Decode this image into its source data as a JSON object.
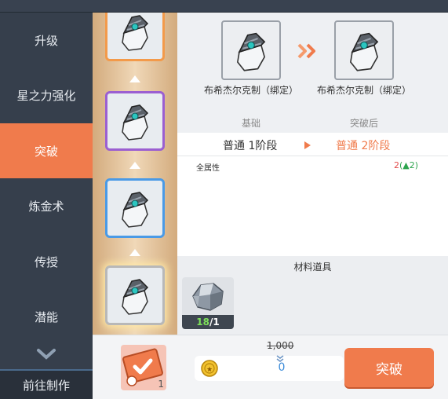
{
  "sidebar": {
    "items": [
      {
        "label": "升级",
        "active": false
      },
      {
        "label": "星之力强化",
        "active": false
      },
      {
        "label": "突破",
        "active": true
      },
      {
        "label": "炼金术",
        "active": false
      },
      {
        "label": "传授",
        "active": false
      },
      {
        "label": "潜能",
        "active": false
      }
    ],
    "footer_label": "前往制作"
  },
  "item_column": {
    "slots": [
      {
        "border": "orange",
        "icon": "glove-icon"
      },
      {
        "border": "purple",
        "icon": "glove-icon"
      },
      {
        "border": "blue",
        "icon": "glove-icon"
      },
      {
        "border": "current",
        "icon": "glove-icon"
      }
    ]
  },
  "compare": {
    "before": {
      "name": "布希杰尔克制（绑定）",
      "tag": "基础"
    },
    "after": {
      "name": "布希杰尔克制（绑定）",
      "tag": "突破后"
    },
    "stage_before": "普通 1阶段",
    "stage_after": "普通 2阶段"
  },
  "attributes": [
    {
      "label": "全属性",
      "value": "2",
      "increase": "(▲2)"
    }
  ],
  "materials": {
    "title": "材料道具",
    "items": [
      {
        "icon": "ore-icon",
        "owned": "18",
        "required": "/1"
      }
    ]
  },
  "bottom": {
    "ticket_count": "1",
    "cost_old": "1,000",
    "cost_new": "0",
    "break_label": "突破"
  },
  "colors": {
    "accent": "#f07b4c",
    "sidebar_bg": "#363f4c",
    "cost_blue": "#3b8bd9",
    "increase_green": "#2da44e",
    "value_red": "#e24a4a"
  }
}
